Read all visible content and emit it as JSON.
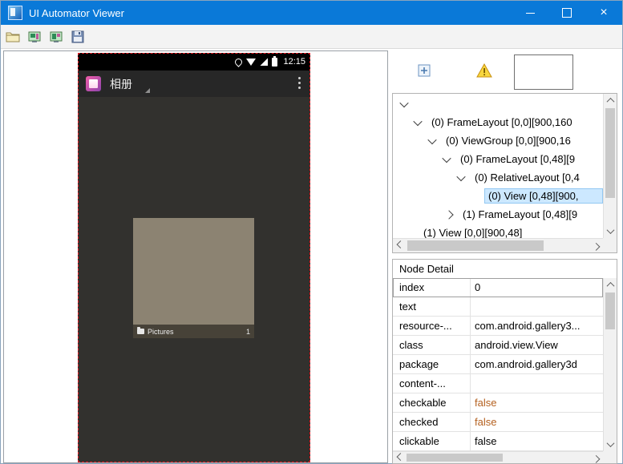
{
  "window": {
    "title": "UI Automator Viewer",
    "close_glyph": "×"
  },
  "main_toolbar": {
    "buttons": [
      "open",
      "device-screenshot",
      "device-screenshot-compressed",
      "save"
    ]
  },
  "device_screen": {
    "status_bar": {
      "time": "12:15"
    },
    "app_bar": {
      "title": "相册"
    },
    "album_tile": {
      "label": "Pictures",
      "count": "1"
    }
  },
  "tree": {
    "items": [
      {
        "label": ""
      },
      {
        "label": "(0) FrameLayout [0,0][900,160"
      },
      {
        "label": "(0) ViewGroup [0,0][900,16"
      },
      {
        "label": "(0) FrameLayout [0,48][9"
      },
      {
        "label": "(0) RelativeLayout [0,4"
      },
      {
        "label": "(0) View [0,48][900,"
      },
      {
        "label": "(1) FrameLayout [0,48][9"
      },
      {
        "label": "(1) View [0,0][900,48]"
      }
    ]
  },
  "node_detail": {
    "title": "Node Detail",
    "rows": [
      {
        "label": "index",
        "value": "0"
      },
      {
        "label": "text",
        "value": ""
      },
      {
        "label": "resource-...",
        "value": "com.android.gallery3..."
      },
      {
        "label": "class",
        "value": "android.view.View"
      },
      {
        "label": "package",
        "value": "com.android.gallery3d"
      },
      {
        "label": "content-...",
        "value": ""
      },
      {
        "label": "checkable",
        "value": "false"
      },
      {
        "label": "checked",
        "value": "false"
      },
      {
        "label": "clickable",
        "value": "false"
      }
    ]
  },
  "colors": {
    "titlebar_blue": "#0a79d8",
    "selection_bg": "#cce8ff",
    "highlight_red": "#ee1c25",
    "accent_value": "#b4601f"
  }
}
